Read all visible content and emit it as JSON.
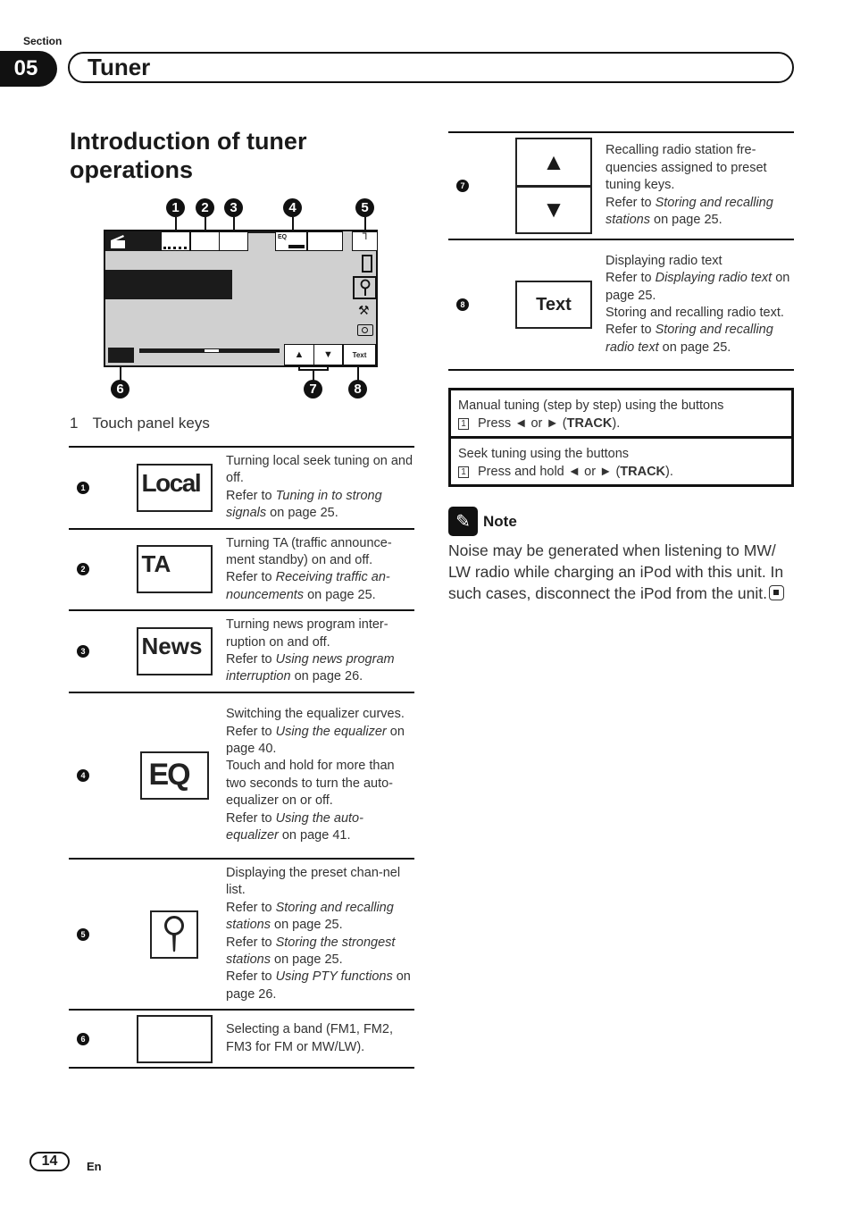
{
  "header": {
    "section_label": "Section",
    "section_number": "05",
    "section_title": "Tuner"
  },
  "page_title": "Introduction of tuner operations",
  "figure": {
    "callouts": [
      "1",
      "2",
      "3",
      "4",
      "5",
      "6",
      "7",
      "8"
    ],
    "screen": {
      "eq_label": "EQ",
      "text_button": "Text",
      "up_arrow": "▲",
      "down_arrow": "▼"
    },
    "caption_number": "1",
    "caption": "Touch panel keys"
  },
  "keys_left": [
    {
      "num": "1",
      "key_label": "Local",
      "icon": "local-key",
      "desc": [
        {
          "t": "Turning local seek tuning on and off."
        },
        {
          "t": "Refer to "
        },
        {
          "i": "Tuning in to strong signals"
        },
        {
          "t": " on page 25."
        }
      ]
    },
    {
      "num": "2",
      "key_label": "TA",
      "icon": "ta-key",
      "desc": [
        {
          "t": "Turning TA (traffic announce-ment standby) on and off."
        },
        {
          "t": "Refer to "
        },
        {
          "i": "Receiving traffic an-nouncements"
        },
        {
          "t": " on page 25."
        }
      ]
    },
    {
      "num": "3",
      "key_label": "News",
      "icon": "news-key",
      "desc": [
        {
          "t": "Turning news program inter-ruption on and off."
        },
        {
          "t": "Refer to "
        },
        {
          "i": "Using news program interruption"
        },
        {
          "t": " on page 26."
        }
      ]
    },
    {
      "num": "4",
      "key_label": "EQ",
      "icon": "eq-key",
      "desc": [
        {
          "t": "Switching the equalizer curves."
        },
        {
          "t": "Refer to "
        },
        {
          "i": "Using the equalizer"
        },
        {
          "t": " on page 40."
        },
        {
          "t": "Touch and hold for more than two seconds to turn the auto-equalizer on or off."
        },
        {
          "t": "Refer to "
        },
        {
          "i": "Using the auto-equalizer"
        },
        {
          "t": " on page 41."
        }
      ]
    },
    {
      "num": "5",
      "key_label": "",
      "icon": "search-list-key",
      "desc": [
        {
          "t": "Displaying the preset chan-nel list."
        },
        {
          "t": "Refer to "
        },
        {
          "i": "Storing and recalling stations"
        },
        {
          "t": " on page 25."
        },
        {
          "t": "Refer to "
        },
        {
          "i": "Storing the strongest stations"
        },
        {
          "t": " on page 25."
        },
        {
          "t": "Refer to "
        },
        {
          "i": "Using PTY functions"
        },
        {
          "t": " on page 26."
        }
      ]
    },
    {
      "num": "6",
      "key_label": "",
      "icon": "band-key",
      "desc": [
        {
          "t": "Selecting a band (FM1, FM2, FM3 for FM or MW/LW)."
        }
      ]
    }
  ],
  "keys_right": [
    {
      "num": "7",
      "key_label_up": "▲",
      "key_label_down": "▼",
      "icon": "preset-up-down-keys",
      "desc": [
        {
          "t": "Recalling radio station fre-quencies assigned to preset tuning keys."
        },
        {
          "t": "Refer to "
        },
        {
          "i": "Storing and recalling stations"
        },
        {
          "t": " on page 25."
        }
      ]
    },
    {
      "num": "8",
      "key_label": "Text",
      "icon": "text-key",
      "desc": [
        {
          "t": "Displaying radio text"
        },
        {
          "t": "Refer to "
        },
        {
          "i": "Displaying radio text"
        },
        {
          "t": " on page 25."
        },
        {
          "t": "Storing and recalling radio text."
        },
        {
          "t": "Refer to "
        },
        {
          "i": "Storing and recalling radio text"
        },
        {
          "t": " on page 25."
        }
      ]
    }
  ],
  "tuning": [
    {
      "heading": "Manual tuning (step by step) using the buttons",
      "step_num": "1",
      "step_pre": "Press ◄ or ► (",
      "step_bold": "TRACK",
      "step_post": ")."
    },
    {
      "heading": "Seek tuning using the buttons",
      "step_num": "1",
      "step_pre": "Press and hold ◄ or ► (",
      "step_bold": "TRACK",
      "step_post": ")."
    }
  ],
  "note": {
    "label": "Note",
    "text": "Noise may be generated when listening to MW/ LW radio while charging an iPod with this unit. In such cases, disconnect the iPod from the unit."
  },
  "footer": {
    "page_number": "14",
    "language": "En"
  }
}
